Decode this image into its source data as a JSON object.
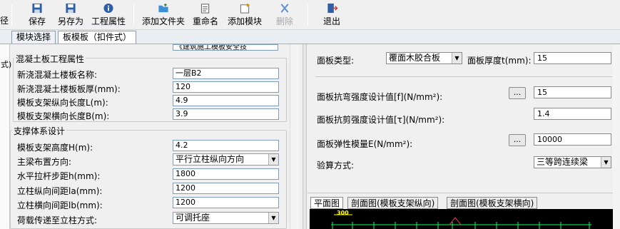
{
  "toolbar": {
    "cut_label": "径",
    "buttons": [
      {
        "label": "保存",
        "icon": "floppy-disk-icon"
      },
      {
        "label": "另存为",
        "icon": "save-as-icon"
      },
      {
        "label": "工程属性",
        "icon": "info-icon"
      },
      {
        "label": "添加文件夹",
        "icon": "add-folder-icon"
      },
      {
        "label": "重命名",
        "icon": "rename-icon"
      },
      {
        "label": "添加模块",
        "icon": "add-module-icon"
      },
      {
        "label": "删除",
        "icon": "delete-x-icon"
      },
      {
        "label": "退出",
        "icon": "exit-icon"
      }
    ]
  },
  "tabs": [
    {
      "label": "模块选择"
    },
    {
      "label": "板模板（扣件式）"
    }
  ],
  "left_edge_text": "式)",
  "left": {
    "top_select_value": "《建筑施工模板安全技",
    "group1": {
      "title": "混凝土板工程属性",
      "rows": [
        {
          "label": "新浇混凝土楼板名称:",
          "value": "一层B2"
        },
        {
          "label": "新浇混凝土楼板板厚(mm):",
          "value": "120"
        },
        {
          "label": "模板支架纵向长度L(m):",
          "value": "4.9"
        },
        {
          "label": "模板支架横向长度B(m):",
          "value": "3.9"
        }
      ]
    },
    "group2": {
      "title": "支撑体系设计",
      "rows": [
        {
          "label": "模板支架高度H(m):",
          "value": "4.2",
          "type": "input"
        },
        {
          "label": "主梁布置方向:",
          "value": "平行立柱纵向方向",
          "type": "select"
        },
        {
          "label": "水平拉杆步距h(mm):",
          "value": "1800",
          "type": "input"
        },
        {
          "label": "立柱纵向间距la(mm):",
          "value": "1200",
          "type": "input"
        },
        {
          "label": "立柱横向间距lb(mm):",
          "value": "1200",
          "type": "input"
        },
        {
          "label": "荷载传递至立柱方式:",
          "value": "可调托座",
          "type": "select"
        }
      ]
    }
  },
  "right": {
    "panel_type_label": "面板类型:",
    "panel_type_value": "覆面木胶合板",
    "thickness_label": "面板厚度t(mm):",
    "thickness_value": "15",
    "bending_label": "面板抗弯强度设计值[f](N/mm²):",
    "bending_value": "15",
    "shear_label": "面板抗剪强度设计值[τ](N/mm²):",
    "shear_value": "1.4",
    "modulus_label": "面板弹性模量E(N/mm²):",
    "modulus_value": "10000",
    "check_label": "验算方式:",
    "check_value": "三等跨连续梁",
    "dot_button": "..."
  },
  "view_tabs": [
    {
      "label": "平面图"
    },
    {
      "label": "剖面图(模板支架纵向)"
    },
    {
      "label": "剖面图(模板支架横向)"
    }
  ],
  "preview_label": "300"
}
